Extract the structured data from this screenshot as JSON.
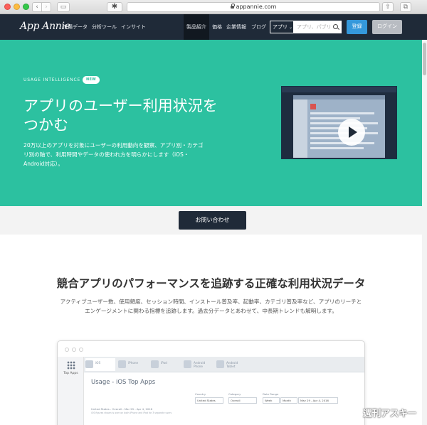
{
  "browser": {
    "url": "appannie.com",
    "back_glyph": "‹",
    "forward_glyph": "›",
    "sidebar_glyph": "▭",
    "extension_glyph": "✱",
    "share_glyph": "⇧",
    "tabs_glyph": "⧉"
  },
  "nav": {
    "logo": "App Annie",
    "left_links": [
      "市場データ",
      "分析ツール",
      "インサイト"
    ],
    "right_links": [
      "製品紹介",
      "価格",
      "企業情報",
      "ブログ"
    ],
    "search_scope": "アプリ",
    "search_placeholder": "アプリ、パブリ",
    "register_label": "登録",
    "login_label": "ログイン"
  },
  "hero": {
    "label": "USAGE INTELLIGENCE",
    "badge": "NEW",
    "title_line1": "アプリのユーザー利用状況を",
    "title_line2": "つかむ",
    "desc_line1": "20万以上のアプリを対象にユーザーの利用動向を観察、アプリ別・カテゴ",
    "desc_line2": "リ別の軸で、利用時間やデータの使われ方を明らかにします（iOS・",
    "desc_line3": "Android対応）。"
  },
  "cta": {
    "contact_label": "お問い合わせ"
  },
  "section": {
    "title": "競合アプリのパフォーマンスを追跡する正確な利用状況データ",
    "desc_line1": "アクティブユーザー数、使用頻度、セッション時間、インストール普及率、起動率、カテゴリ普及率など、アプリのリーチと",
    "desc_line2": "エンゲージメントに関わる指標を追跡します。過去分データとあわせて、中長期トレンドも解明します。"
  },
  "mockup": {
    "side_label": "Top Apps",
    "tabs": [
      "iOS",
      "iPhone",
      "iPad",
      "Android Phone",
      "Android Tablet"
    ],
    "heading": "Usage - iOS Top Apps",
    "filters": {
      "country_label": "Country",
      "country_value": "United States",
      "category_label": "Category",
      "category_value": "Overall",
      "date_label": "Date Range",
      "week": "Week",
      "month": "Month",
      "date_value": "May 29 - Apr 4, 2016"
    },
    "meta": "United States - Overall - Mar 29 - Apr 4, 2016",
    "meta2": "iOS figures shown is over on both iPhone and iPad for 3 separate users"
  },
  "watermark": "週刊アスキー"
}
